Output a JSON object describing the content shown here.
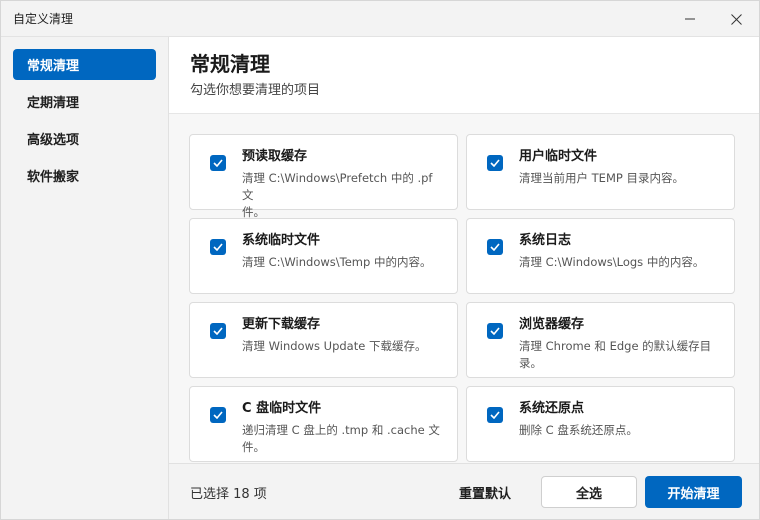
{
  "window": {
    "title": "自定义清理"
  },
  "sidebar": {
    "items": [
      {
        "label": "常规清理",
        "active": true
      },
      {
        "label": "定期清理",
        "active": false
      },
      {
        "label": "高级选项",
        "active": false
      },
      {
        "label": "软件搬家",
        "active": false
      }
    ]
  },
  "header": {
    "title": "常规清理",
    "subtitle": "勾选你想要清理的项目"
  },
  "cards": [
    {
      "title": "预读取缓存",
      "desc_line1": "清理 C:\\Windows\\Prefetch 中的 .pf 文",
      "desc_line2": "件。",
      "checked": true
    },
    {
      "title": "用户临时文件",
      "desc_line1": "清理当前用户 TEMP 目录内容。",
      "desc_line2": "",
      "checked": true
    },
    {
      "title": "系统临时文件",
      "desc_line1": "清理 C:\\Windows\\Temp 中的内容。",
      "desc_line2": "",
      "checked": true
    },
    {
      "title": "系统日志",
      "desc_line1": "清理 C:\\Windows\\Logs 中的内容。",
      "desc_line2": "",
      "checked": true
    },
    {
      "title": "更新下载缓存",
      "desc_line1": "清理 Windows Update 下载缓存。",
      "desc_line2": "",
      "checked": true
    },
    {
      "title": "浏览器缓存",
      "desc_line1": "清理 Chrome 和 Edge 的默认缓存目",
      "desc_line2": "录。",
      "checked": true
    },
    {
      "title": "C 盘临时文件",
      "desc_line1": "递归清理 C 盘上的 .tmp 和 .cache 文",
      "desc_line2": "件。",
      "checked": true
    },
    {
      "title": "系统还原点",
      "desc_line1": "删除 C 盘系统还原点。",
      "desc_line2": "",
      "checked": true
    }
  ],
  "footer": {
    "count": "已选择 18 项",
    "reset_label": "重置默认",
    "select_all_label": "全选",
    "start_label": "开始清理"
  },
  "colors": {
    "accent": "#0067c0",
    "sidebar_bg": "#f3f3f3",
    "content_bg": "#f7f7f7"
  },
  "icons": {
    "minimize": "minimize-icon",
    "close": "close-icon",
    "checkbox": "checkmark-icon"
  }
}
